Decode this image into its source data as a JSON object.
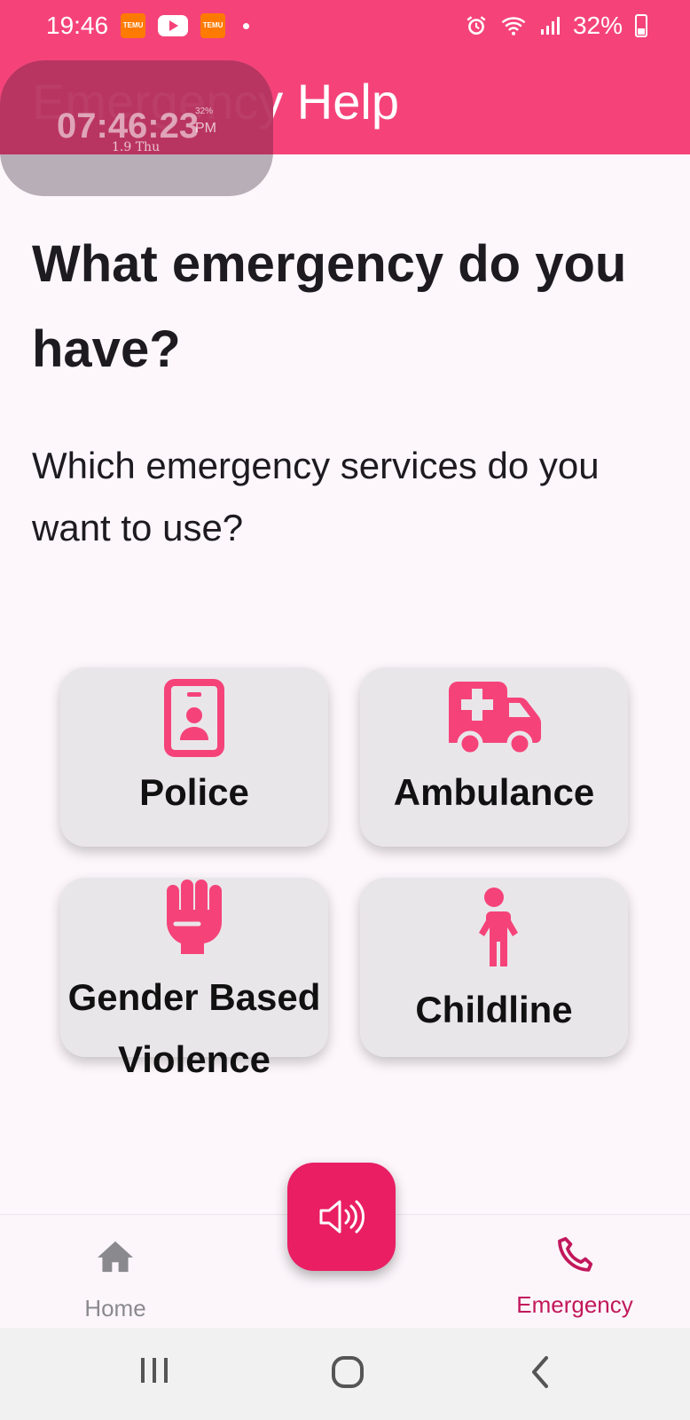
{
  "status_bar": {
    "time": "19:46",
    "battery_percent": "32%",
    "notification_icons": [
      "temu-icon",
      "youtube-icon",
      "temu-icon",
      "dot-icon"
    ],
    "system_icons": [
      "alarm-icon",
      "wifi-icon",
      "signal-icon",
      "battery-icon"
    ]
  },
  "overlay_clock": {
    "time": "07:46:23",
    "ampm": "PM",
    "battery": "32%",
    "date": "1.9 Thu"
  },
  "app_bar": {
    "title": "Emergency Help"
  },
  "main": {
    "headline": "What emergency do you have?",
    "subheadline": "Which emergency services do you want to use?",
    "services": [
      {
        "label": "Police",
        "icon": "police-badge-icon"
      },
      {
        "label": "Ambulance",
        "icon": "ambulance-icon"
      },
      {
        "label": "Gender Based Violence",
        "icon": "fist-icon"
      },
      {
        "label": "Childline",
        "icon": "child-icon"
      }
    ]
  },
  "fab": {
    "icon": "speaker-icon"
  },
  "bottom_nav": {
    "items": [
      {
        "label": "Home",
        "icon": "home-icon",
        "selected": false
      },
      {
        "label": "Emergency",
        "icon": "phone-icon",
        "selected": true
      }
    ]
  },
  "system_nav": {
    "buttons": [
      "recents-icon",
      "home-circle-icon",
      "back-icon"
    ]
  },
  "colors": {
    "accent": "#f5437a",
    "fab": "#e91e63",
    "selected_nav": "#c2185b",
    "card": "#e9e6ea",
    "background": "#fdf7fb"
  }
}
